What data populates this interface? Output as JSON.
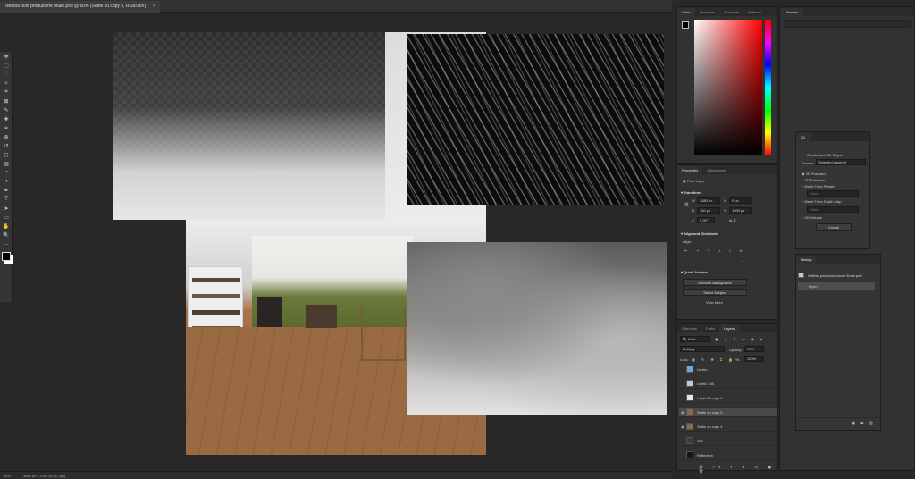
{
  "document": {
    "tab_title": "Nebbia post produzione finale.psd @ 50% (Sedie su copy 5, RGB/16#)",
    "close_glyph": "×"
  },
  "status_bar": {
    "zoom": "50%",
    "doc_size": "3880 px x 2202 px (72 ppi)"
  },
  "toolbar": {
    "tools": [
      "move-icon",
      "marquee-icon",
      "lasso-icon",
      "quick-select-icon",
      "crop-icon",
      "frame-icon",
      "eyedropper-icon",
      "healing-icon",
      "brush-icon",
      "stamp-icon",
      "history-brush-icon",
      "eraser-icon",
      "gradient-icon",
      "blur-icon",
      "dodge-icon",
      "pen-icon",
      "type-icon",
      "path-select-icon",
      "shape-icon",
      "hand-icon",
      "zoom-icon",
      "more-icon"
    ]
  },
  "color_panel": {
    "tabs": [
      "Color",
      "Swatches",
      "Gradients",
      "Patterns"
    ],
    "hue_base": "#ff0000"
  },
  "libraries_panel": {
    "tabs": [
      "Libraries"
    ]
  },
  "properties_panel": {
    "tabs": [
      "Properties",
      "Adjustments"
    ],
    "layer_kind": "Pixel Layer",
    "transform_heading": "Transform",
    "w": "1880 px",
    "x": "0 px",
    "h": "760 px",
    "y": "1900 px",
    "angle": "0,00°",
    "align_heading": "Align and Distribute",
    "align_label": "Align:",
    "more_dots": "...",
    "quick_actions_heading": "Quick Actions",
    "remove_bg": "Remove Background",
    "select_subject": "Select Subject",
    "view_more": "View More"
  },
  "panel_3d": {
    "tabs": [
      "3D"
    ],
    "create_label": "Create New 3D Object",
    "source_label": "Source:",
    "source_value": "Selected Layer(s)",
    "options": [
      "3D Postcard",
      "3D Extrusion",
      "Mesh From Preset",
      "Mesh From Depth Map",
      "3D Volume"
    ],
    "preset_value": "None",
    "depth_value": "Plane",
    "create_button": "Create"
  },
  "history_panel": {
    "tabs": [
      "History"
    ],
    "file_item": "Nebbia post produzione finale.psd",
    "open_item": "Open"
  },
  "layers_panel": {
    "tabs": [
      "Channels",
      "Paths",
      "Layers"
    ],
    "kind_filter": "Kind",
    "blend_mode": "Multiply",
    "opacity_label": "Opacity:",
    "opacity_value": "17%",
    "lock_label": "Lock:",
    "fill_label": "Fill:",
    "fill_value": "100%",
    "layers": [
      {
        "name": "Livello 1",
        "visible": false,
        "selected": false,
        "thumb": "#6fa8d8"
      },
      {
        "name": "Livello 150",
        "visible": false,
        "selected": false,
        "thumb": "#b7c9e6"
      },
      {
        "name": "Layer 99 copy 4",
        "visible": false,
        "selected": false,
        "thumb": "#e5e5e5"
      },
      {
        "name": "Sedie su copy 5",
        "visible": true,
        "selected": true,
        "thumb": "#8a6a4a"
      },
      {
        "name": "Sedie su copy 4",
        "visible": true,
        "selected": false,
        "thumb": "#8a6a4a"
      },
      {
        "name": "002",
        "visible": false,
        "selected": false,
        "thumb": "#4a3a2a"
      },
      {
        "name": "Reflection",
        "visible": false,
        "selected": false,
        "thumb": "#151515"
      }
    ]
  }
}
